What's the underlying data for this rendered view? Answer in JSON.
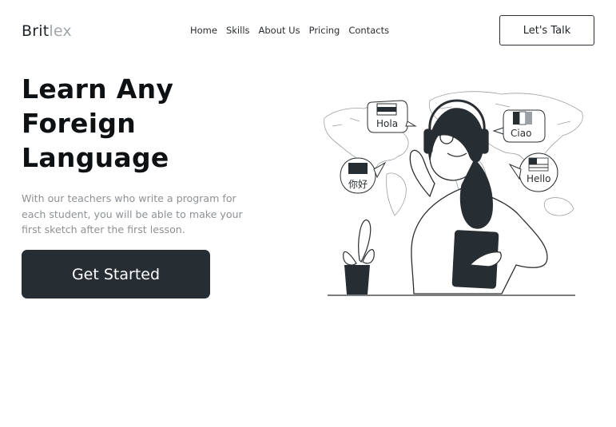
{
  "brand": {
    "part1": "Brit",
    "part2": "lex"
  },
  "nav": {
    "items": [
      "Home",
      "Skills",
      "About Us",
      "Pricing",
      "Contacts"
    ]
  },
  "header": {
    "cta_label": "Let's Talk"
  },
  "hero": {
    "title_lines": [
      "Learn Any",
      "Foreign",
      "Language"
    ],
    "description": "With our teachers who write a program for each student, you will be able to make your first sketch after the first lesson.",
    "cta_label": "Get Started"
  },
  "illustration": {
    "bubbles": [
      "Hola",
      "Ciao",
      "你好",
      "Hello"
    ]
  },
  "colors": {
    "primary": "#262d33",
    "muted_text": "#8d9196",
    "brand_muted": "#a3a7ab"
  }
}
